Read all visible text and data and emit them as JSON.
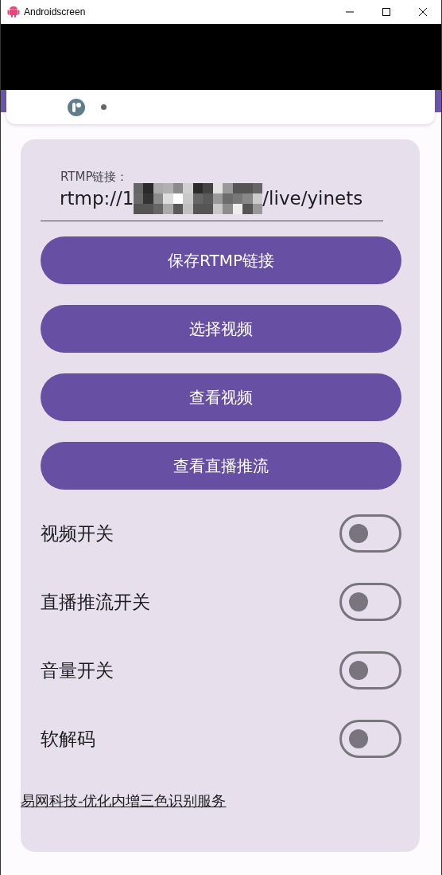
{
  "window": {
    "title": "Androidscreen"
  },
  "rtmp": {
    "label": "RTMP链接：",
    "value_start": "rtmp://1",
    "value_end": "/live/yinets"
  },
  "buttons": [
    "保存RTMP链接",
    "选择视频",
    "查看视频",
    "查看直播推流"
  ],
  "switches": [
    {
      "label": "视频开关",
      "on": false
    },
    {
      "label": "直播推流开关",
      "on": false
    },
    {
      "label": "音量开关",
      "on": false
    },
    {
      "label": "软解码",
      "on": false
    }
  ],
  "link": "易网科技-优化内增三色识别服务"
}
